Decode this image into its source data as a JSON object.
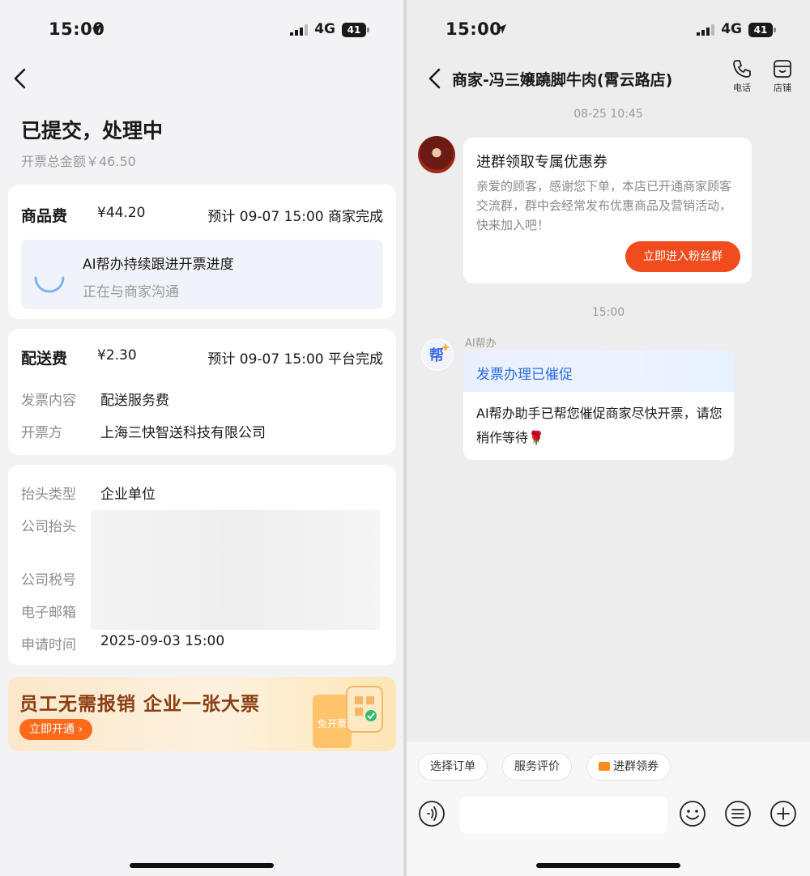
{
  "left": {
    "status": {
      "time": "15:00",
      "network": "4G",
      "battery": "41"
    },
    "title": "已提交，处理中",
    "total": "开票总金额￥46.50",
    "goods": {
      "name": "商品费",
      "amount": "¥44.20",
      "eta": "预计 09-07 15:00 商家完成",
      "ai_title": "AI帮办持续跟进开票进度",
      "ai_status": "正在与商家沟通"
    },
    "delivery": {
      "name": "配送费",
      "amount": "¥2.30",
      "eta": "预计 09-07 15:00 平台完成",
      "rows": [
        {
          "k": "发票内容",
          "v": "配送服务费"
        },
        {
          "k": "开票方",
          "v": "上海三快智送科技有限公司"
        }
      ]
    },
    "header_info": {
      "type_label": "抬头类型",
      "type_value": "企业单位",
      "company_label": "公司抬头",
      "tax_label": "公司税号",
      "email_label": "电子邮箱",
      "time_label": "申请时间",
      "time_value": "2025-09-03 15:00"
    },
    "banner": {
      "text": "员工无需报销  企业一张大票",
      "button": "立即开通 ›",
      "art_label": "免开票"
    }
  },
  "right": {
    "status": {
      "time": "15:00",
      "network": "4G",
      "battery": "41"
    },
    "shop_name": "商家-冯三嬢蹺脚牛肉(霄云路店)",
    "phone_label": "电话",
    "store_label": "店铺",
    "time1": "08-25 10:45",
    "promo": {
      "title": "进群领取专属优惠券",
      "text": "亲爱的顾客，感谢您下单，本店已开通商家顾客交流群，群中会经常发布优惠商品及营销活动，快来加入吧！",
      "button": "立即进入粉丝群"
    },
    "time2": "15:00",
    "ai_sender": "AI帮办",
    "ai_avatar_text": "帮",
    "ai_title": "发票办理已催促",
    "ai_body": "AI帮办助手已帮您催促商家尽快开票，请您稍作等待🌹",
    "chips": [
      "选择订单",
      "服务评价",
      "进群领券"
    ]
  },
  "colors": {
    "accent_orange": "#f04c1d",
    "ai_blue": "#2b6de5"
  }
}
